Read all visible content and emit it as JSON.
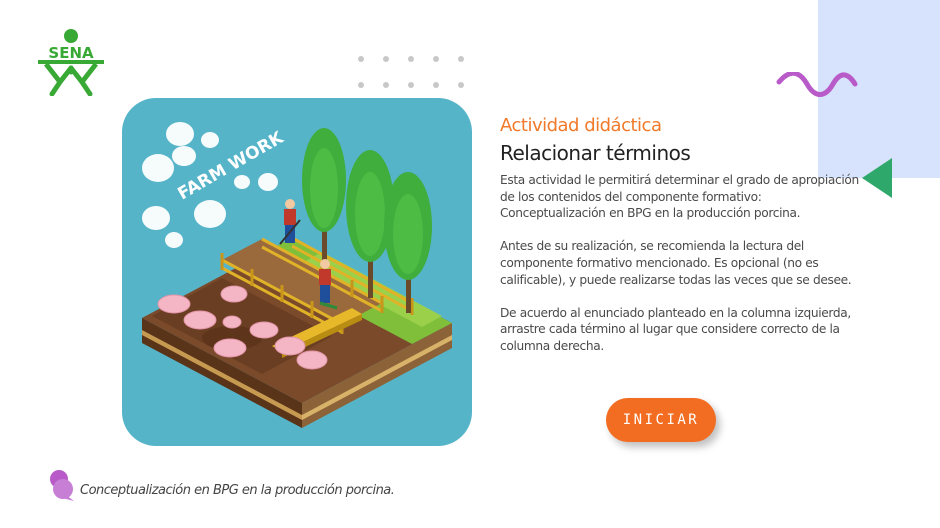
{
  "logo": {
    "text": "SENA",
    "color": "#39a935"
  },
  "intro": {
    "kicker": "Actividad didáctica",
    "title": "Relacionar términos",
    "paragraphs": [
      "Esta actividad le permitirá determinar el grado de apropiación de los contenidos del componente formativo: Conceptualización en  BPG en la producción porcina.",
      "Antes de su realización, se recomienda la lectura del componente formativo mencionado.  Es opcional (no es calificable), y puede realizarse todas las veces que se desee.",
      "De acuerdo al enunciado planteado en la columna izquierda, arrastre cada término al lugar que considere correcto de la columna derecha."
    ]
  },
  "illustration": {
    "caption_text": "FARM WORK"
  },
  "start_button": {
    "label": "INICIAR"
  },
  "footer": {
    "text": "Conceptualización en  BPG en la producción porcina."
  },
  "colors": {
    "accent_orange": "#f07a2a",
    "button_orange": "#f26d21",
    "panel_blue": "#d7e2fd",
    "wave_purple": "#b85bc9",
    "triangle_green": "#2fa86b",
    "hero_blue": "#56b4c9"
  }
}
